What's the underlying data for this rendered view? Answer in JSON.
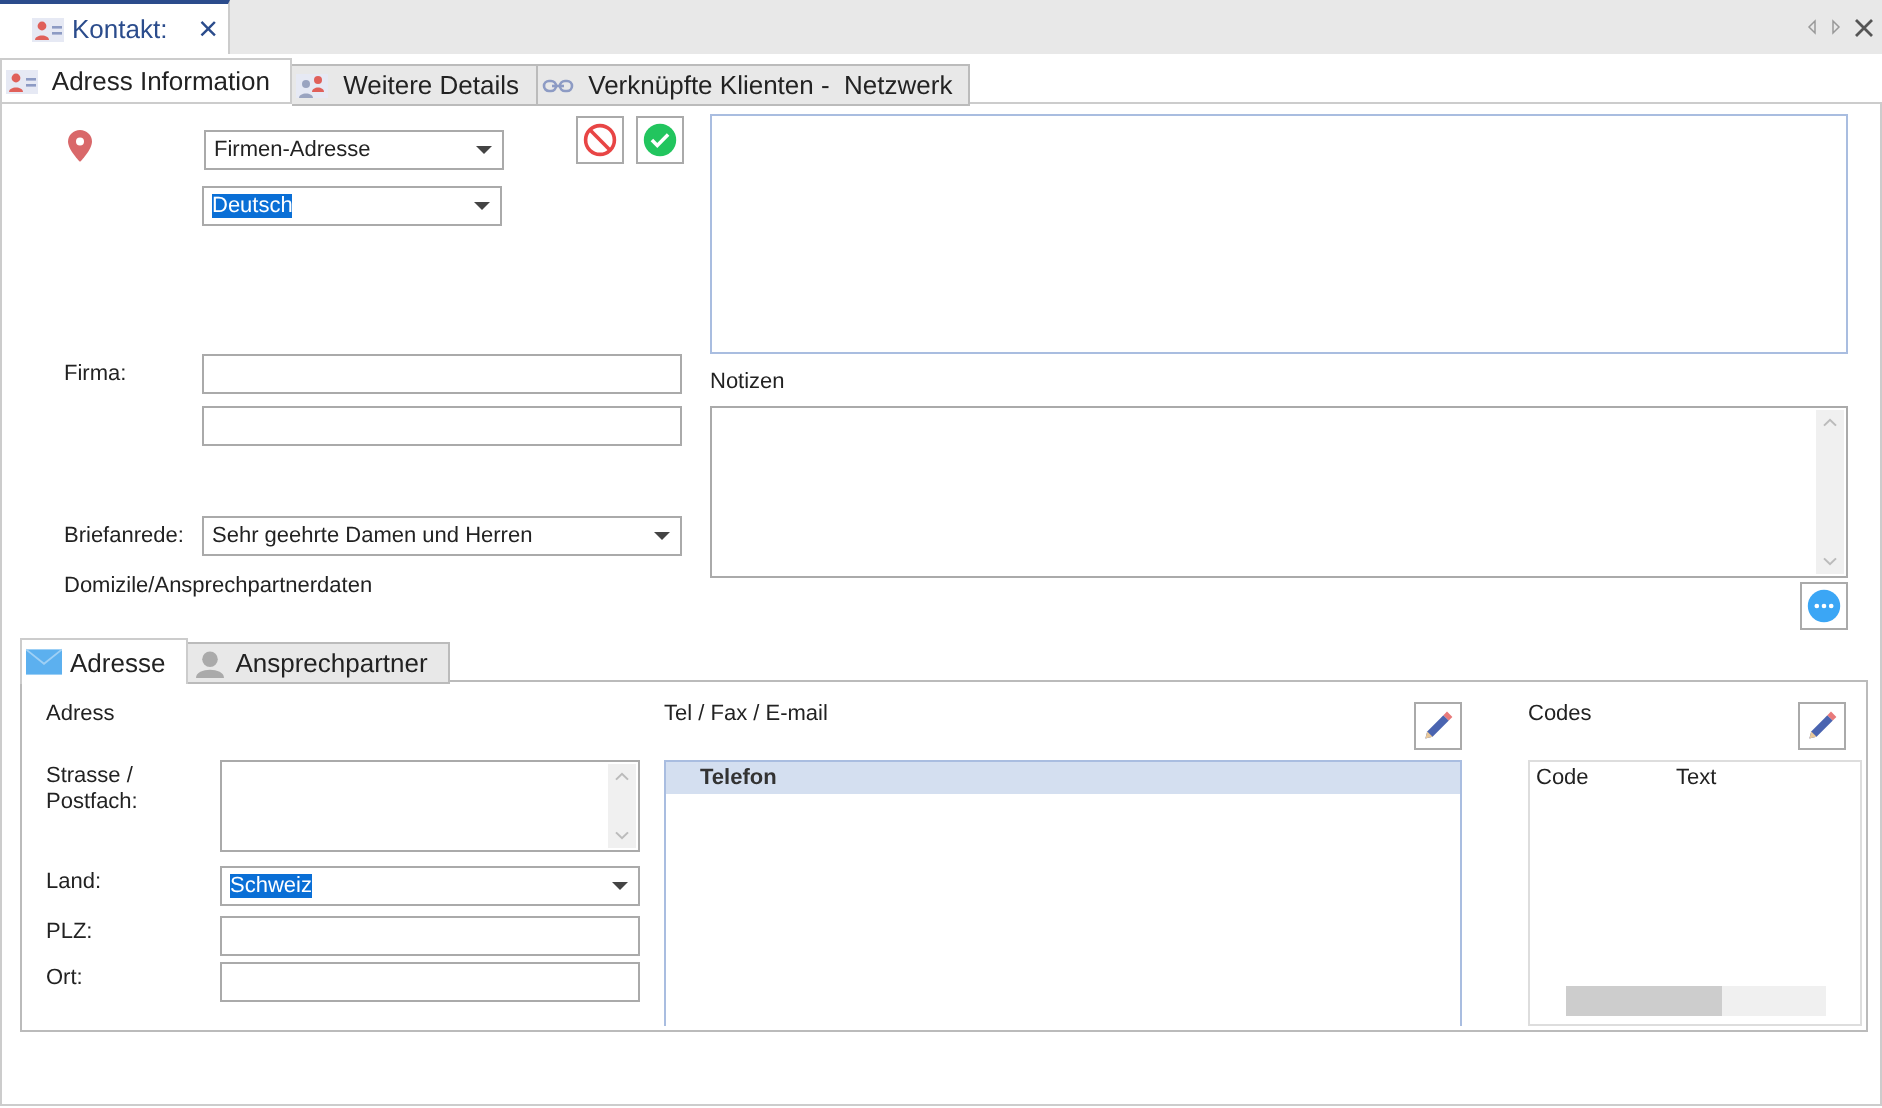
{
  "document_tab": {
    "title": "Kontakt:",
    "close": "×"
  },
  "tabs": [
    {
      "label": "Adress Information",
      "kind": "contact",
      "selected": true
    },
    {
      "label": "Weitere Details",
      "kind": "details",
      "selected": false
    },
    {
      "label": "Verknüpfte Klienten -  Netzwerk",
      "kind": "link",
      "selected": false
    }
  ],
  "address_type": {
    "value": "Firmen-Adresse",
    "text_selected": false
  },
  "language": {
    "value": "Deutsch",
    "text_selected": true
  },
  "firma": {
    "label": "Firma:"
  },
  "briefanrede": {
    "label": "Briefanrede:",
    "value": "Sehr geehrte Damen und Herren",
    "text_selected": false
  },
  "section_label": "Domizile/Ansprechpartnerdaten",
  "notes": {
    "label": "Notizen"
  },
  "subtabs": [
    {
      "label": "Adresse",
      "kind": "mail",
      "selected": true
    },
    {
      "label": "Ansprechpartner",
      "kind": "person",
      "selected": false
    }
  ],
  "address": {
    "heading": "Adress",
    "strasse_label": "Strasse / Postfach:",
    "land_label": "Land:",
    "land": {
      "value": "Schweiz",
      "text_selected": true
    },
    "plz_label": "PLZ:",
    "ort_label": "Ort:"
  },
  "contact_list": {
    "heading": "Tel / Fax / E-mail",
    "rows": [
      {
        "label": "Telefon",
        "kind": "group"
      }
    ]
  },
  "codes": {
    "heading": "Codes",
    "columns": [
      "Code",
      "Text"
    ]
  }
}
